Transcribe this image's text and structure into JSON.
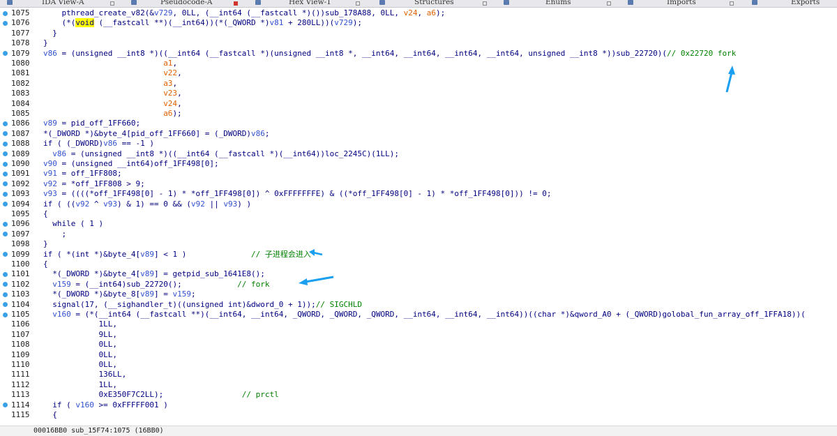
{
  "tabs": [
    {
      "label": "IDA View-A",
      "active": false
    },
    {
      "label": "Pseudocode-A",
      "active": true
    },
    {
      "label": "Hex View-1",
      "active": false
    },
    {
      "label": "Structures",
      "active": false
    },
    {
      "label": "Enums",
      "active": false
    },
    {
      "label": "Imports",
      "active": false
    },
    {
      "label": "Exports",
      "active": false
    }
  ],
  "status_text": "00016BB0 sub_15F74:1075 (16BB0)",
  "code_lines": [
    {
      "n": "1075",
      "dot": true
    },
    {
      "n": "1076",
      "dot": true
    },
    {
      "n": "1077",
      "dot": false
    },
    {
      "n": "1078",
      "dot": false
    },
    {
      "n": "1079",
      "dot": true
    },
    {
      "n": "1080",
      "dot": false
    },
    {
      "n": "1081",
      "dot": false
    },
    {
      "n": "1082",
      "dot": false
    },
    {
      "n": "1083",
      "dot": false
    },
    {
      "n": "1084",
      "dot": false
    },
    {
      "n": "1085",
      "dot": false
    },
    {
      "n": "1086",
      "dot": true
    },
    {
      "n": "1087",
      "dot": true
    },
    {
      "n": "1088",
      "dot": true
    },
    {
      "n": "1089",
      "dot": true
    },
    {
      "n": "1090",
      "dot": true
    },
    {
      "n": "1091",
      "dot": true
    },
    {
      "n": "1092",
      "dot": true
    },
    {
      "n": "1093",
      "dot": true
    },
    {
      "n": "1094",
      "dot": true
    },
    {
      "n": "1095",
      "dot": false
    },
    {
      "n": "1096",
      "dot": true
    },
    {
      "n": "1097",
      "dot": true
    },
    {
      "n": "1098",
      "dot": false
    },
    {
      "n": "1099",
      "dot": true
    },
    {
      "n": "1100",
      "dot": false
    },
    {
      "n": "1101",
      "dot": true
    },
    {
      "n": "1102",
      "dot": true
    },
    {
      "n": "1103",
      "dot": true
    },
    {
      "n": "1104",
      "dot": true
    },
    {
      "n": "1105",
      "dot": true
    },
    {
      "n": "1106",
      "dot": false
    },
    {
      "n": "1107",
      "dot": false
    },
    {
      "n": "1108",
      "dot": false
    },
    {
      "n": "1109",
      "dot": false
    },
    {
      "n": "1110",
      "dot": false
    },
    {
      "n": "1111",
      "dot": false
    },
    {
      "n": "1112",
      "dot": false
    },
    {
      "n": "1113",
      "dot": false
    },
    {
      "n": "1114",
      "dot": true
    },
    {
      "n": "1115",
      "dot": false
    }
  ],
  "code_text": [
    [
      [
        "k",
        "    pthread_create_v82(&"
      ],
      [
        "v",
        "v729"
      ],
      [
        "k",
        ", 0LL, (__int64 (__fastcall *)())sub_178A88, 0LL, "
      ],
      [
        "n",
        "v24"
      ],
      [
        "k",
        ", "
      ],
      [
        "n",
        "a6"
      ],
      [
        "k",
        ");"
      ]
    ],
    [
      [
        "k",
        "    (*("
      ],
      [
        "hl",
        "void"
      ],
      [
        "k",
        " (__fastcall **)(__int64))(*(_QWORD *)"
      ],
      [
        "v",
        "v81"
      ],
      [
        "k",
        " + 280LL))("
      ],
      [
        "v",
        "v729"
      ],
      [
        "k",
        ");"
      ]
    ],
    [
      [
        "k",
        "  }"
      ]
    ],
    [
      [
        "k",
        "}"
      ]
    ],
    [
      [
        "v",
        "v86"
      ],
      [
        "k",
        " = (unsigned __int8 *)((__int64 (__fastcall *)(unsigned __int8 *, __int64, __int64, __int64, __int64, unsigned __int8 *))sub_22720)("
      ],
      [
        "c",
        "// 0x22720 fork"
      ]
    ],
    [
      [
        "k",
        "                          "
      ],
      [
        "n",
        "a1"
      ],
      [
        "k",
        ","
      ]
    ],
    [
      [
        "k",
        "                          "
      ],
      [
        "n",
        "v22"
      ],
      [
        "k",
        ","
      ]
    ],
    [
      [
        "k",
        "                          "
      ],
      [
        "n",
        "a3"
      ],
      [
        "k",
        ","
      ]
    ],
    [
      [
        "k",
        "                          "
      ],
      [
        "n",
        "v23"
      ],
      [
        "k",
        ","
      ]
    ],
    [
      [
        "k",
        "                          "
      ],
      [
        "n",
        "v24"
      ],
      [
        "k",
        ","
      ]
    ],
    [
      [
        "k",
        "                          "
      ],
      [
        "n",
        "a6"
      ],
      [
        "k",
        ");"
      ]
    ],
    [
      [
        "v",
        "v89"
      ],
      [
        "k",
        " = pid_off_1FF660;"
      ]
    ],
    [
      [
        "k",
        "*(_DWORD *)&byte_4[pid_off_1FF660] = (_DWORD)"
      ],
      [
        "v",
        "v86"
      ],
      [
        "k",
        ";"
      ]
    ],
    [
      [
        "k",
        "if ( (_DWORD)"
      ],
      [
        "v",
        "v86"
      ],
      [
        "k",
        " == -1 )"
      ]
    ],
    [
      [
        "k",
        "  "
      ],
      [
        "v",
        "v86"
      ],
      [
        "k",
        " = (unsigned __int8 *)((__int64 (__fastcall *)(__int64))loc_2245C)(1LL);"
      ]
    ],
    [
      [
        "v",
        "v90"
      ],
      [
        "k",
        " = (unsigned __int64)off_1FF498[0];"
      ]
    ],
    [
      [
        "v",
        "v91"
      ],
      [
        "k",
        " = off_1FF808;"
      ]
    ],
    [
      [
        "v",
        "v92"
      ],
      [
        "k",
        " = *off_1FF808 > 9;"
      ]
    ],
    [
      [
        "v",
        "v93"
      ],
      [
        "k",
        " = ((((*off_1FF498[0] - 1) * *off_1FF498[0]) ^ 0xFFFFFFFE) & ((*off_1FF498[0] - 1) * *off_1FF498[0])) != 0;"
      ]
    ],
    [
      [
        "k",
        "if ( (("
      ],
      [
        "v",
        "v92"
      ],
      [
        "k",
        " ^ "
      ],
      [
        "v",
        "v93"
      ],
      [
        "k",
        ") & 1) == 0 && ("
      ],
      [
        "v",
        "v92"
      ],
      [
        "k",
        " || "
      ],
      [
        "v",
        "v93"
      ],
      [
        "k",
        ") )"
      ]
    ],
    [
      [
        "k",
        "{"
      ]
    ],
    [
      [
        "k",
        "  while ( 1 )"
      ]
    ],
    [
      [
        "k",
        "    ;"
      ]
    ],
    [
      [
        "k",
        "}"
      ]
    ],
    [
      [
        "k",
        "if ( *(int *)&byte_4["
      ],
      [
        "v",
        "v89"
      ],
      [
        "k",
        "] < 1 )              "
      ],
      [
        "c",
        "// 子进程会进入"
      ]
    ],
    [
      [
        "k",
        "{"
      ]
    ],
    [
      [
        "k",
        "  *(_DWORD *)&byte_4["
      ],
      [
        "v",
        "v89"
      ],
      [
        "k",
        "] = getpid_sub_1641E8();"
      ]
    ],
    [
      [
        "k",
        "  "
      ],
      [
        "v",
        "v159"
      ],
      [
        "k",
        " = (__int64)sub_22720();            "
      ],
      [
        "c",
        "// fork"
      ]
    ],
    [
      [
        "k",
        "  *(_DWORD *)&byte_8["
      ],
      [
        "v",
        "v89"
      ],
      [
        "k",
        "] = "
      ],
      [
        "v",
        "v159"
      ],
      [
        "k",
        ";"
      ]
    ],
    [
      [
        "k",
        "  signal(17, (__sighandler_t)((unsigned int)&dword_0 + 1));"
      ],
      [
        "c",
        "// SIGCHLD"
      ]
    ],
    [
      [
        "k",
        "  "
      ],
      [
        "v",
        "v160"
      ],
      [
        "k",
        " = (*(__int64 (__fastcall **)(__int64, __int64, _QWORD, _QWORD, _QWORD, __int64, __int64, __int64))((char *)&qword_A0 + (_QWORD)golobal_fun_array_off_1FFA18))("
      ]
    ],
    [
      [
        "k",
        "            1LL,"
      ]
    ],
    [
      [
        "k",
        "            9LL,"
      ]
    ],
    [
      [
        "k",
        "            0LL,"
      ]
    ],
    [
      [
        "k",
        "            0LL,"
      ]
    ],
    [
      [
        "k",
        "            0LL,"
      ]
    ],
    [
      [
        "k",
        "            136LL,"
      ]
    ],
    [
      [
        "k",
        "            1LL,"
      ]
    ],
    [
      [
        "k",
        "            0xE350F7C2LL);                 "
      ],
      [
        "c",
        "// prctl"
      ]
    ],
    [
      [
        "k",
        "  if ( "
      ],
      [
        "v",
        "v160"
      ],
      [
        "k",
        " >= 0xFFFFF001 )"
      ]
    ],
    [
      [
        "k",
        "  {"
      ]
    ]
  ]
}
